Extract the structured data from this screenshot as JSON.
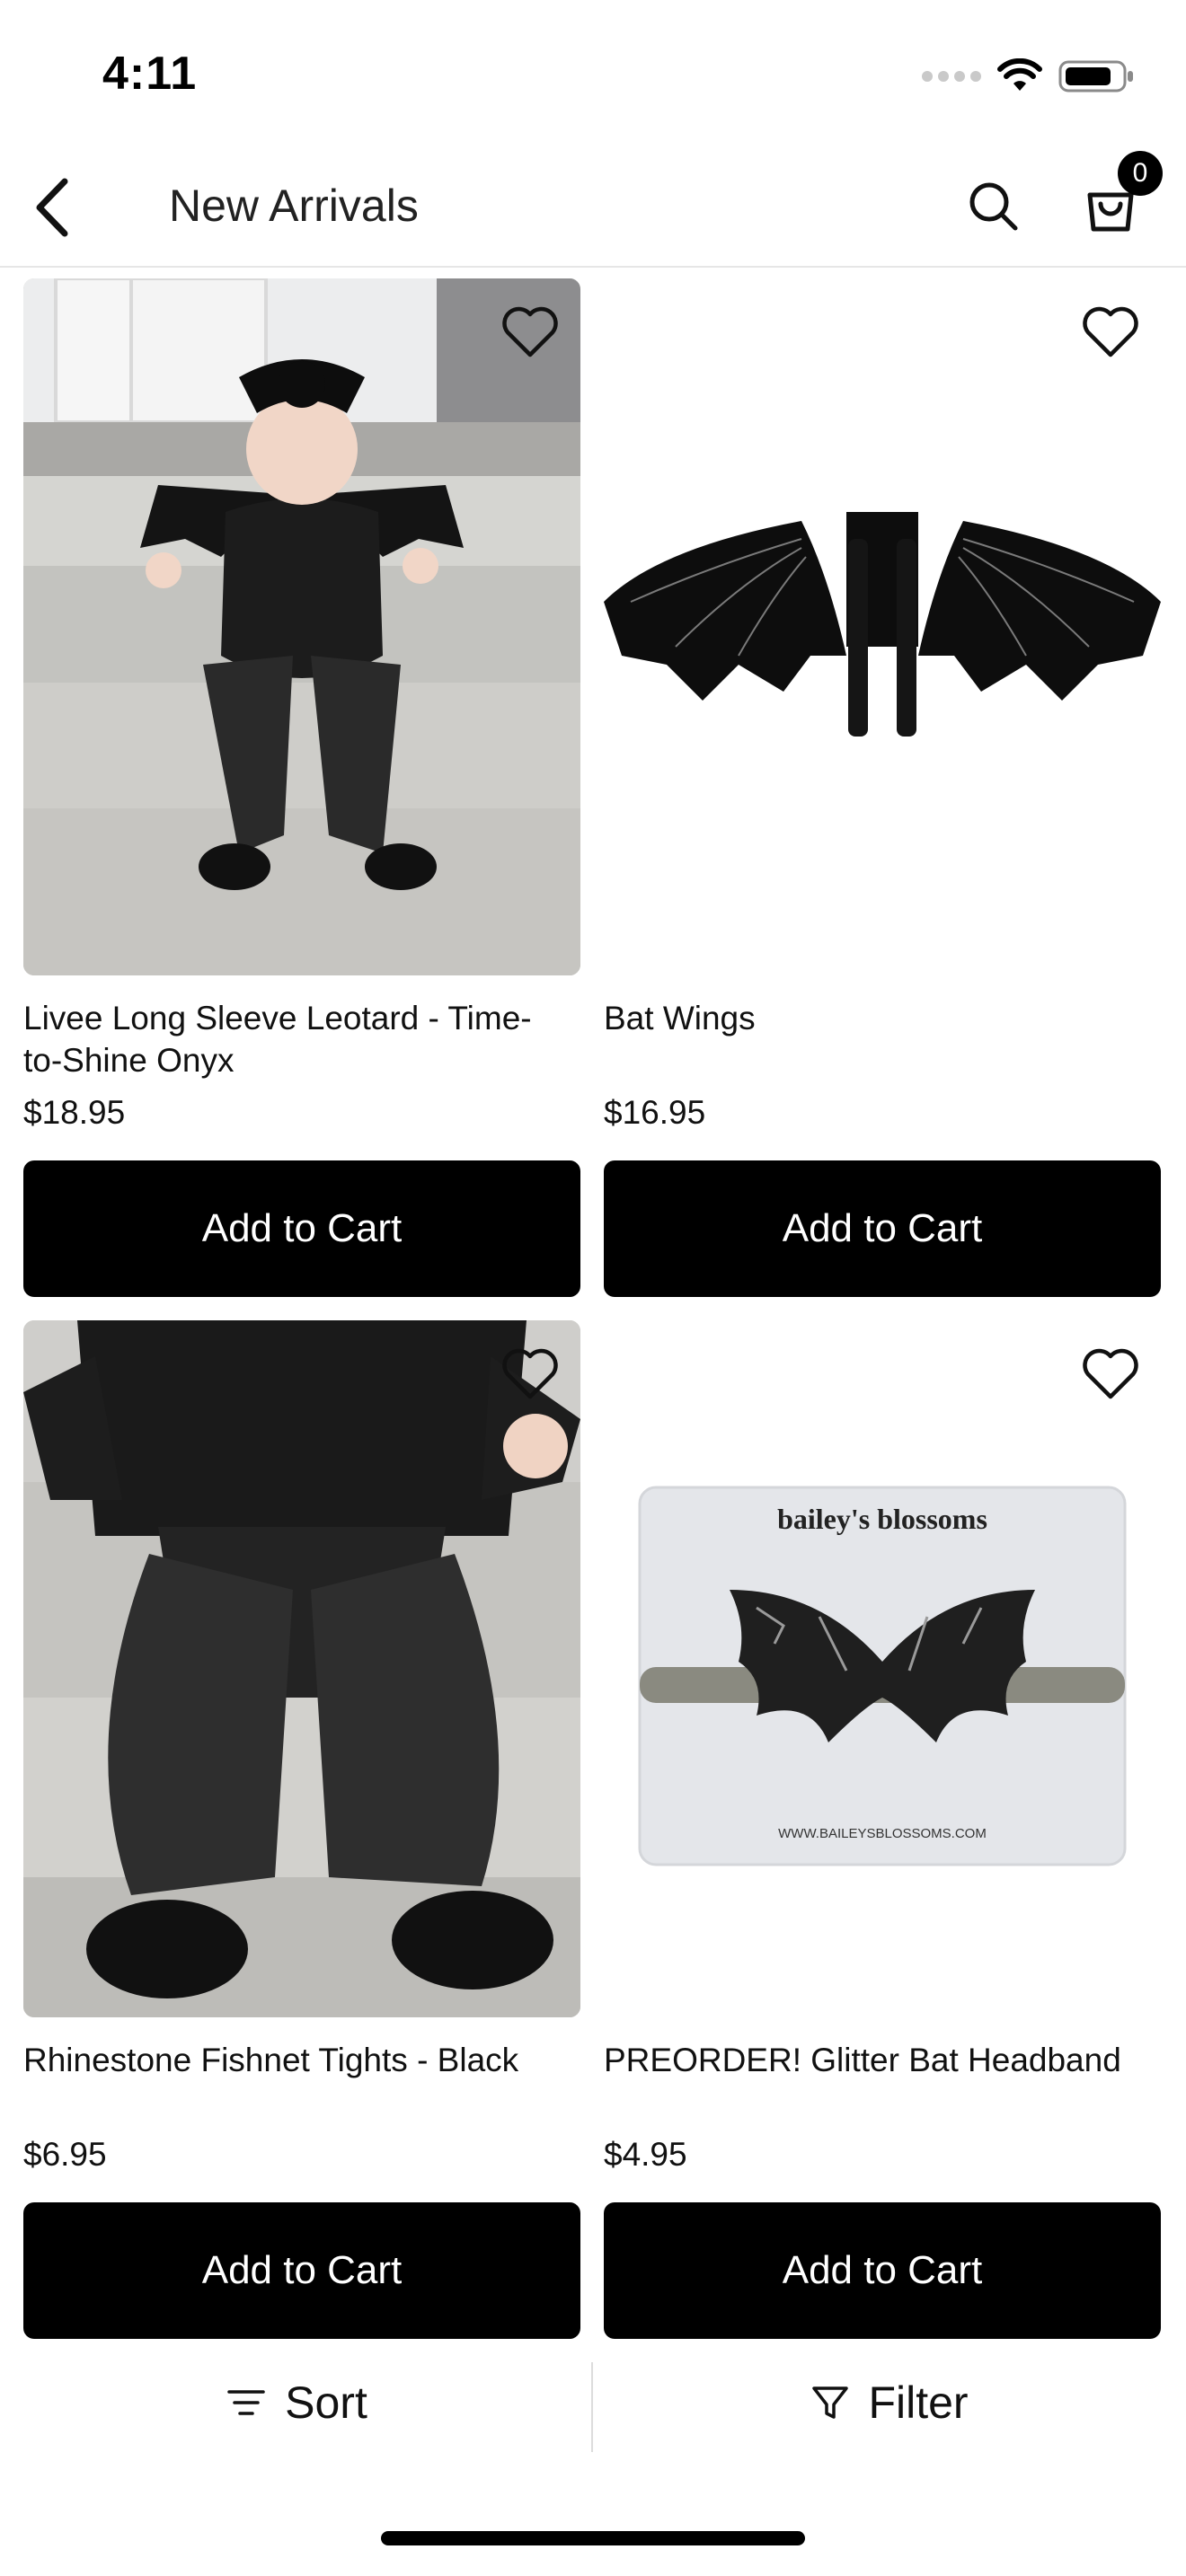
{
  "status_bar": {
    "time": "4:11"
  },
  "nav": {
    "title": "New Arrivals",
    "cart_count": "0"
  },
  "products": [
    {
      "name": "Livee Long Sleeve Leotard - Time-to-Shine Onyx",
      "price": "$18.95",
      "button": "Add to Cart"
    },
    {
      "name": "Bat Wings",
      "price": "$16.95",
      "button": "Add to Cart"
    },
    {
      "name": "Rhinestone Fishnet Tights - Black",
      "price": "$6.95",
      "button": "Add to Cart"
    },
    {
      "name": "PREORDER! Glitter Bat Headband",
      "price": "$4.95",
      "button": "Add to Cart",
      "image_card_brand": "bailey's blossoms",
      "image_card_url": "WWW.BAILEYSBLOSSOMS.COM"
    }
  ],
  "bottom_bar": {
    "sort_label": "Sort",
    "filter_label": "Filter"
  },
  "icons": {
    "back": "chevron-left-icon",
    "search": "search-icon",
    "cart": "shopping-bag-icon",
    "wishlist": "heart-outline-icon",
    "sort": "sort-lines-icon",
    "filter": "funnel-icon"
  },
  "colors": {
    "primary_button": "#000000",
    "button_text": "#ffffff",
    "divider": "#e6e6e6"
  }
}
